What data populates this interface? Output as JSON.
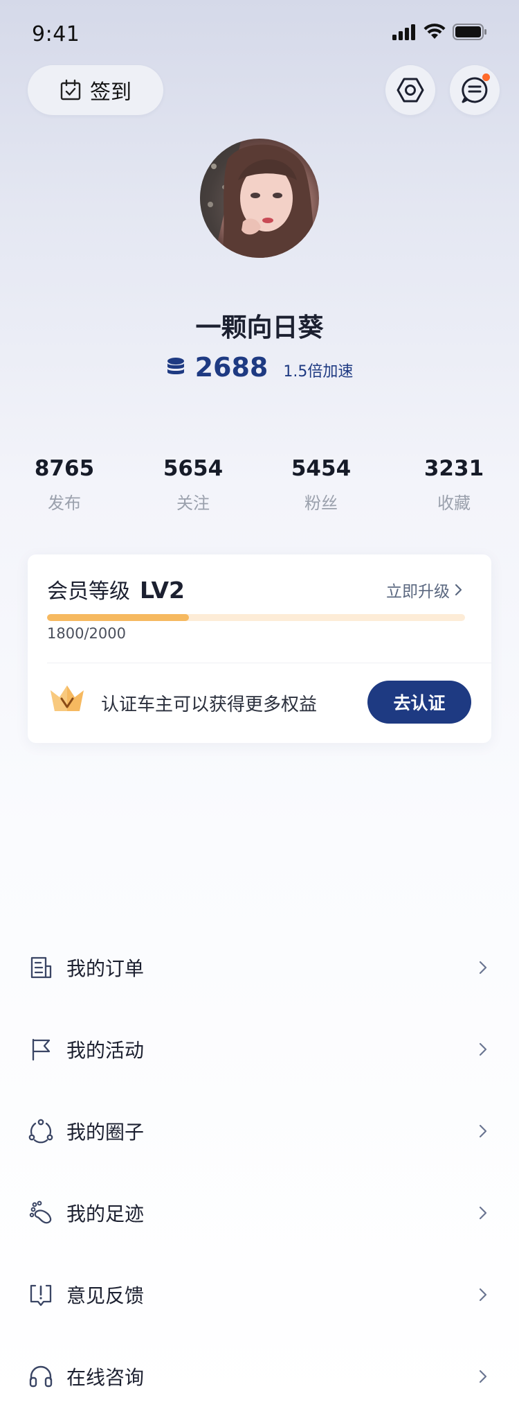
{
  "status_bar": {
    "time": "9:41"
  },
  "header": {
    "signin_label": "签到",
    "settings_icon": "hexagon-settings-icon",
    "message_icon": "message-icon",
    "message_dot_color": "#ff6a2b"
  },
  "profile": {
    "nickname": "一颗向日葵",
    "points": "2688",
    "points_speed": "1.5倍加速"
  },
  "stats": [
    {
      "value": "8765",
      "label": "发布"
    },
    {
      "value": "5654",
      "label": "关注"
    },
    {
      "value": "5454",
      "label": "粉丝"
    },
    {
      "value": "3231",
      "label": "收藏"
    }
  ],
  "member": {
    "title": "会员等级",
    "level": "LV2",
    "upgrade_label": "立即升级",
    "progress_text": "1800/2000",
    "progress_fraction": 0.34,
    "verify_text": "认证车主可以获得更多权益",
    "verify_button": "去认证"
  },
  "menu": [
    {
      "label": "我的订单",
      "icon": "order-icon"
    },
    {
      "label": "我的活动",
      "icon": "flag-icon"
    },
    {
      "label": "我的圈子",
      "icon": "circle-group-icon"
    },
    {
      "label": "我的足迹",
      "icon": "footprint-icon"
    },
    {
      "label": "意见反馈",
      "icon": "feedback-icon"
    },
    {
      "label": "在线咨询",
      "icon": "headset-icon"
    }
  ],
  "colors": {
    "brand": "#1e3a82",
    "progress_fill": "#f6b960",
    "progress_track": "#fdecd7"
  }
}
